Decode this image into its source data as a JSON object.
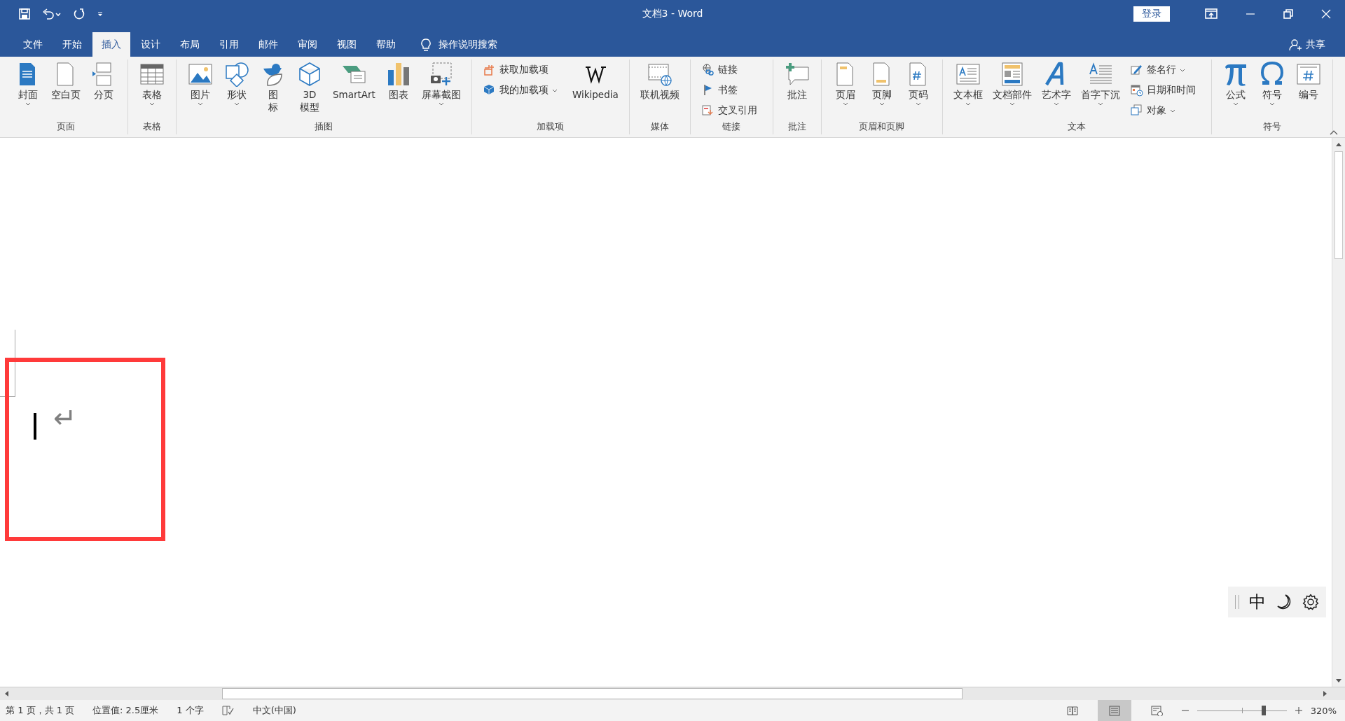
{
  "window": {
    "title": "文档3  -  Word",
    "sign_in": "登录"
  },
  "tabs": [
    {
      "label": "文件",
      "selected": false
    },
    {
      "label": "开始",
      "selected": false
    },
    {
      "label": "插入",
      "selected": true
    },
    {
      "label": "设计",
      "selected": false
    },
    {
      "label": "布局",
      "selected": false
    },
    {
      "label": "引用",
      "selected": false
    },
    {
      "label": "邮件",
      "selected": false
    },
    {
      "label": "审阅",
      "selected": false
    },
    {
      "label": "视图",
      "selected": false
    },
    {
      "label": "帮助",
      "selected": false
    }
  ],
  "tell_me": "操作说明搜索",
  "share": "共享",
  "ribbon": {
    "groups": [
      {
        "label": "页面",
        "items": [
          {
            "kind": "large",
            "label": "封面",
            "dropdown": true
          },
          {
            "kind": "large",
            "label": "空白页",
            "dropdown": false
          },
          {
            "kind": "large",
            "label": "分页",
            "dropdown": false
          }
        ]
      },
      {
        "label": "表格",
        "items": [
          {
            "kind": "large",
            "label": "表格",
            "dropdown": true
          }
        ]
      },
      {
        "label": "插图",
        "items": [
          {
            "kind": "large",
            "label": "图片",
            "dropdown": true
          },
          {
            "kind": "large",
            "label": "形状",
            "dropdown": true
          },
          {
            "kind": "large",
            "label": "图标",
            "dropdown": false,
            "wrapped": true
          },
          {
            "kind": "large",
            "label": "3D\n模型",
            "dropdown": false
          },
          {
            "kind": "large",
            "label": "SmartArt",
            "dropdown": false
          },
          {
            "kind": "large",
            "label": "图表",
            "dropdown": false
          },
          {
            "kind": "large",
            "label": "屏幕截图",
            "dropdown": true
          }
        ]
      },
      {
        "label": "加载项",
        "items": [
          {
            "kind": "stack",
            "items": [
              {
                "label": "获取加载项",
                "dropdown": false
              },
              {
                "label": "我的加载项",
                "dropdown": true
              }
            ]
          },
          {
            "kind": "large",
            "label": "Wikipedia",
            "dropdown": false
          }
        ]
      },
      {
        "label": "媒体",
        "items": [
          {
            "kind": "large",
            "label": "联机视频",
            "dropdown": false
          }
        ]
      },
      {
        "label": "链接",
        "items": [
          {
            "kind": "stack",
            "items": [
              {
                "label": "链接",
                "dropdown": false
              },
              {
                "label": "书签",
                "dropdown": false
              },
              {
                "label": "交叉引用",
                "dropdown": false
              }
            ]
          }
        ]
      },
      {
        "label": "批注",
        "items": [
          {
            "kind": "large",
            "label": "批注",
            "dropdown": false
          }
        ]
      },
      {
        "label": "页眉和页脚",
        "items": [
          {
            "kind": "large",
            "label": "页眉",
            "dropdown": true
          },
          {
            "kind": "large",
            "label": "页脚",
            "dropdown": true
          },
          {
            "kind": "large",
            "label": "页码",
            "dropdown": true
          }
        ]
      },
      {
        "label": "文本",
        "items": [
          {
            "kind": "large",
            "label": "文本框",
            "dropdown": true
          },
          {
            "kind": "large",
            "label": "文档部件",
            "dropdown": true
          },
          {
            "kind": "large",
            "label": "艺术字",
            "dropdown": true
          },
          {
            "kind": "large",
            "label": "首字下沉",
            "dropdown": true
          },
          {
            "kind": "stack",
            "items": [
              {
                "label": "签名行",
                "dropdown": true
              },
              {
                "label": "日期和时间",
                "dropdown": false
              },
              {
                "label": "对象",
                "dropdown": true
              }
            ]
          }
        ]
      },
      {
        "label": "符号",
        "items": [
          {
            "kind": "large",
            "label": "公式",
            "dropdown": true
          },
          {
            "kind": "large",
            "label": "符号",
            "dropdown": true
          },
          {
            "kind": "large",
            "label": "编号",
            "dropdown": false
          }
        ]
      }
    ]
  },
  "document": {
    "paragraph_mark": "↵"
  },
  "ime_toolbar": {
    "mode": "中"
  },
  "status_bar": {
    "items": [
      "第 1 页，共 1 页",
      "位置值: 2.5厘米",
      "1 个字"
    ],
    "language": "中文(中国)",
    "views": [
      {
        "selected": false
      },
      {
        "selected": true
      },
      {
        "selected": false
      }
    ],
    "zoom": {
      "level": 0.74,
      "reading": "320%"
    }
  }
}
